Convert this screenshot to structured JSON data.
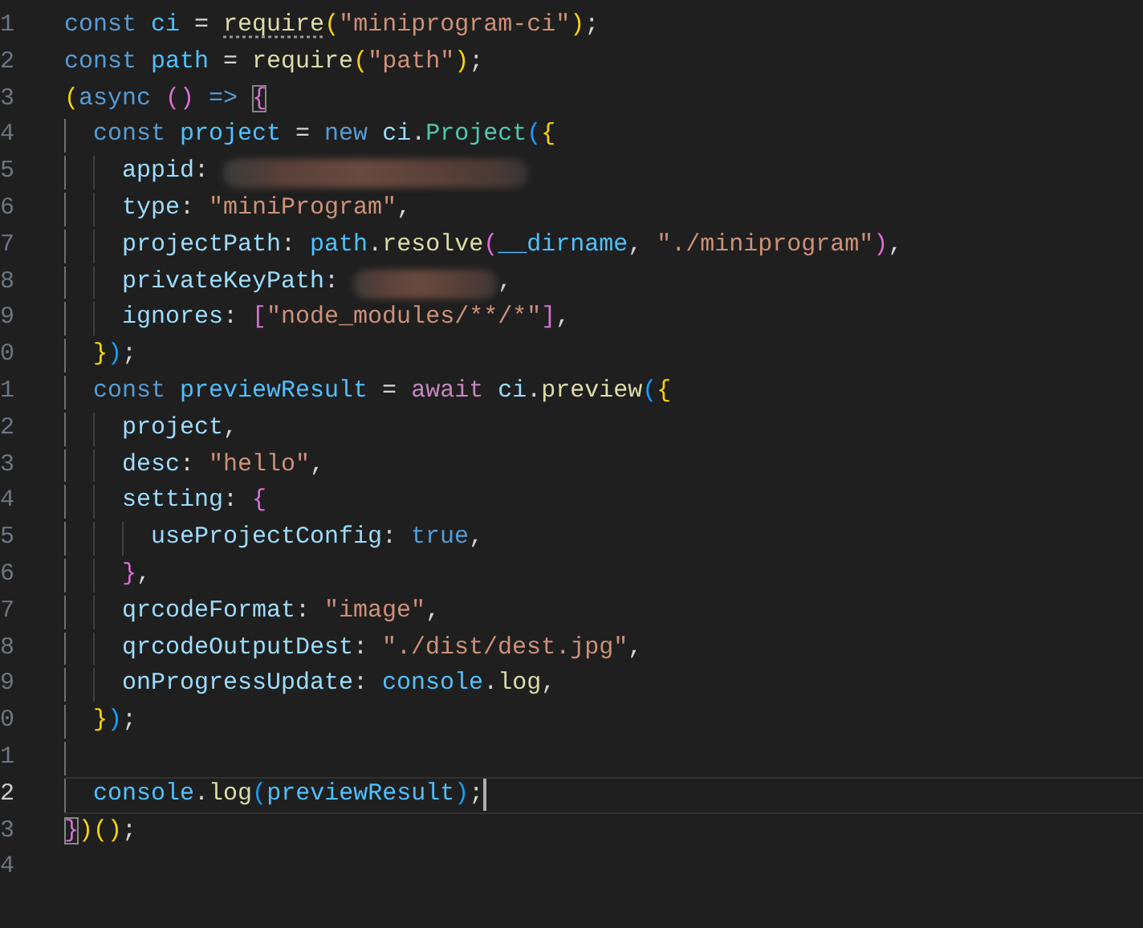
{
  "editor": {
    "lines": [
      {
        "number": "1",
        "current": false,
        "cursor": false,
        "tokens": [
          {
            "kind": "kw",
            "text": "const "
          },
          {
            "kind": "const",
            "text": "ci"
          },
          {
            "kind": "p",
            "text": " = "
          },
          {
            "kind": "fn",
            "text": "require",
            "hint": true
          },
          {
            "kind": "b1",
            "text": "("
          },
          {
            "kind": "str",
            "text": "\"miniprogram-ci\""
          },
          {
            "kind": "b1",
            "text": ")"
          },
          {
            "kind": "p",
            "text": ";"
          }
        ]
      },
      {
        "number": "2",
        "current": false,
        "cursor": false,
        "tokens": [
          {
            "kind": "kw",
            "text": "const "
          },
          {
            "kind": "const",
            "text": "path"
          },
          {
            "kind": "p",
            "text": " = "
          },
          {
            "kind": "fn",
            "text": "require"
          },
          {
            "kind": "b1",
            "text": "("
          },
          {
            "kind": "str",
            "text": "\"path\""
          },
          {
            "kind": "b1",
            "text": ")"
          },
          {
            "kind": "p",
            "text": ";"
          }
        ]
      },
      {
        "number": "3",
        "current": false,
        "cursor": false,
        "tokens": [
          {
            "kind": "b1",
            "text": "("
          },
          {
            "kind": "kw",
            "text": "async "
          },
          {
            "kind": "b2",
            "text": "() "
          },
          {
            "kind": "kw",
            "text": "=> "
          },
          {
            "kind": "b2",
            "text": "{",
            "matched": true
          }
        ]
      },
      {
        "number": "4",
        "current": false,
        "cursor": false,
        "tokens": [
          {
            "kind": "kw",
            "text": "  const "
          },
          {
            "kind": "const",
            "text": "project"
          },
          {
            "kind": "p",
            "text": " = "
          },
          {
            "kind": "kw",
            "text": "new "
          },
          {
            "kind": "var",
            "text": "ci"
          },
          {
            "kind": "p",
            "text": "."
          },
          {
            "kind": "cls",
            "text": "Project"
          },
          {
            "kind": "b3",
            "text": "("
          },
          {
            "kind": "b1",
            "text": "{"
          }
        ]
      },
      {
        "number": "5",
        "current": false,
        "cursor": false,
        "tokens": [
          {
            "kind": "var",
            "text": "    appid"
          },
          {
            "kind": "p",
            "text": ": "
          },
          {
            "kind": "redacted"
          }
        ]
      },
      {
        "number": "6",
        "current": false,
        "cursor": false,
        "tokens": [
          {
            "kind": "var",
            "text": "    type"
          },
          {
            "kind": "p",
            "text": ": "
          },
          {
            "kind": "str",
            "text": "\"miniProgram\""
          },
          {
            "kind": "p",
            "text": ","
          }
        ]
      },
      {
        "number": "7",
        "current": false,
        "cursor": false,
        "tokens": [
          {
            "kind": "var",
            "text": "    projectPath"
          },
          {
            "kind": "p",
            "text": ": "
          },
          {
            "kind": "const",
            "text": "path"
          },
          {
            "kind": "p",
            "text": "."
          },
          {
            "kind": "fn",
            "text": "resolve"
          },
          {
            "kind": "b2",
            "text": "("
          },
          {
            "kind": "const",
            "text": "__dirname"
          },
          {
            "kind": "p",
            "text": ", "
          },
          {
            "kind": "str",
            "text": "\"./miniprogram\""
          },
          {
            "kind": "b2",
            "text": ")"
          },
          {
            "kind": "p",
            "text": ","
          }
        ]
      },
      {
        "number": "8",
        "current": false,
        "cursor": false,
        "tokens": [
          {
            "kind": "var",
            "text": "    privateKeyPath"
          },
          {
            "kind": "p",
            "text": ": "
          },
          {
            "kind": "redacted"
          },
          {
            "kind": "p",
            "text": ","
          }
        ]
      },
      {
        "number": "9",
        "current": false,
        "cursor": false,
        "tokens": [
          {
            "kind": "var",
            "text": "    ignores"
          },
          {
            "kind": "p",
            "text": ": "
          },
          {
            "kind": "b2",
            "text": "["
          },
          {
            "kind": "str",
            "text": "\"node_modules/**/*\""
          },
          {
            "kind": "b2",
            "text": "]"
          },
          {
            "kind": "p",
            "text": ","
          }
        ]
      },
      {
        "number": "0",
        "current": false,
        "cursor": false,
        "tokens": [
          {
            "kind": "b1",
            "text": "  }"
          },
          {
            "kind": "b3",
            "text": ")"
          },
          {
            "kind": "p",
            "text": ";"
          }
        ]
      },
      {
        "number": "1",
        "current": false,
        "cursor": false,
        "tokens": [
          {
            "kind": "kw",
            "text": "  const "
          },
          {
            "kind": "const",
            "text": "previewResult"
          },
          {
            "kind": "p",
            "text": " = "
          },
          {
            "kind": "ctrl",
            "text": "await "
          },
          {
            "kind": "var",
            "text": "ci"
          },
          {
            "kind": "p",
            "text": "."
          },
          {
            "kind": "fn",
            "text": "preview"
          },
          {
            "kind": "b3",
            "text": "("
          },
          {
            "kind": "b1",
            "text": "{"
          }
        ]
      },
      {
        "number": "2",
        "current": false,
        "cursor": false,
        "tokens": [
          {
            "kind": "var",
            "text": "    project"
          },
          {
            "kind": "p",
            "text": ","
          }
        ]
      },
      {
        "number": "3",
        "current": false,
        "cursor": false,
        "tokens": [
          {
            "kind": "var",
            "text": "    desc"
          },
          {
            "kind": "p",
            "text": ": "
          },
          {
            "kind": "str",
            "text": "\"hello\""
          },
          {
            "kind": "p",
            "text": ","
          }
        ]
      },
      {
        "number": "4",
        "current": false,
        "cursor": false,
        "tokens": [
          {
            "kind": "var",
            "text": "    setting"
          },
          {
            "kind": "p",
            "text": ": "
          },
          {
            "kind": "b2",
            "text": "{"
          }
        ]
      },
      {
        "number": "5",
        "current": false,
        "cursor": false,
        "tokens": [
          {
            "kind": "var",
            "text": "      useProjectConfig"
          },
          {
            "kind": "p",
            "text": ": "
          },
          {
            "kind": "kw",
            "text": "true"
          },
          {
            "kind": "p",
            "text": ","
          }
        ]
      },
      {
        "number": "6",
        "current": false,
        "cursor": false,
        "tokens": [
          {
            "kind": "b2",
            "text": "    }"
          },
          {
            "kind": "p",
            "text": ","
          }
        ]
      },
      {
        "number": "7",
        "current": false,
        "cursor": false,
        "tokens": [
          {
            "kind": "var",
            "text": "    qrcodeFormat"
          },
          {
            "kind": "p",
            "text": ": "
          },
          {
            "kind": "str",
            "text": "\"image\""
          },
          {
            "kind": "p",
            "text": ","
          }
        ]
      },
      {
        "number": "8",
        "current": false,
        "cursor": false,
        "tokens": [
          {
            "kind": "var",
            "text": "    qrcodeOutputDest"
          },
          {
            "kind": "p",
            "text": ": "
          },
          {
            "kind": "str",
            "text": "\"./dist/dest.jpg\""
          },
          {
            "kind": "p",
            "text": ","
          }
        ]
      },
      {
        "number": "9",
        "current": false,
        "cursor": false,
        "tokens": [
          {
            "kind": "var",
            "text": "    onProgressUpdate"
          },
          {
            "kind": "p",
            "text": ": "
          },
          {
            "kind": "const",
            "text": "console"
          },
          {
            "kind": "p",
            "text": "."
          },
          {
            "kind": "fn",
            "text": "log"
          },
          {
            "kind": "p",
            "text": ","
          }
        ]
      },
      {
        "number": "0",
        "current": false,
        "cursor": false,
        "tokens": [
          {
            "kind": "b1",
            "text": "  }"
          },
          {
            "kind": "b3",
            "text": ")"
          },
          {
            "kind": "p",
            "text": ";"
          }
        ]
      },
      {
        "number": "1",
        "current": false,
        "cursor": false
      },
      {
        "number": "2",
        "current": true,
        "cursor": true,
        "tokens": [
          {
            "kind": "const",
            "text": "  console"
          },
          {
            "kind": "p",
            "text": "."
          },
          {
            "kind": "fn",
            "text": "log"
          },
          {
            "kind": "b3",
            "text": "("
          },
          {
            "kind": "const",
            "text": "previewResult"
          },
          {
            "kind": "b3",
            "text": ")"
          },
          {
            "kind": "p",
            "text": ";"
          }
        ]
      },
      {
        "number": "3",
        "current": false,
        "cursor": false,
        "tokens": [
          {
            "kind": "b2",
            "text": "}",
            "matched": true
          },
          {
            "kind": "b1",
            "text": ")"
          },
          {
            "kind": "b1",
            "text": "()"
          },
          {
            "kind": "p",
            "text": ";"
          }
        ]
      },
      {
        "number": "4",
        "current": false,
        "cursor": false
      }
    ]
  }
}
